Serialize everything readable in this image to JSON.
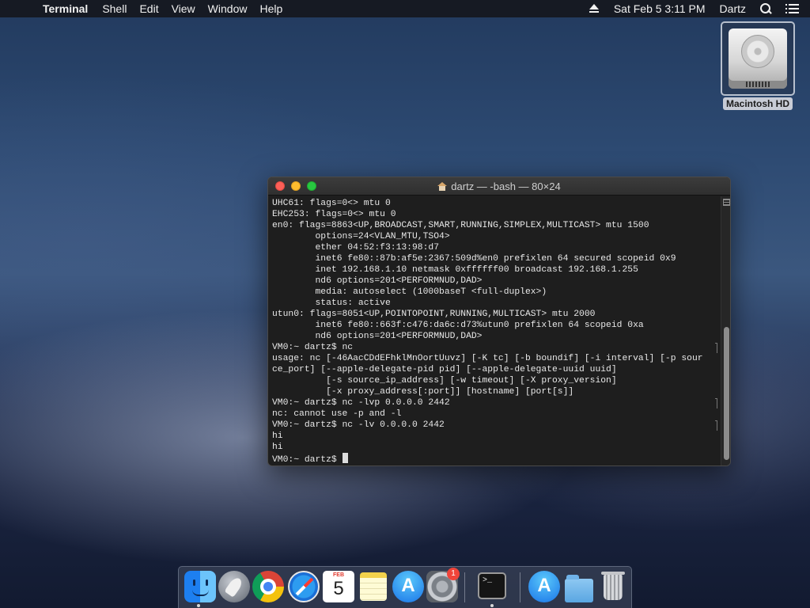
{
  "menubar": {
    "apple_glyph": "",
    "app_name": "Terminal",
    "menus": [
      "Shell",
      "Edit",
      "View",
      "Window",
      "Help"
    ],
    "clock": "Sat Feb 5  3:11 PM",
    "user": "Dartz"
  },
  "desktop": {
    "drive_label": "Macintosh HD"
  },
  "terminal": {
    "title": "dartz — -bash — 80×24",
    "lines": [
      "UHC61: flags=0<> mtu 0",
      "EHC253: flags=0<> mtu 0",
      "en0: flags=8863<UP,BROADCAST,SMART,RUNNING,SIMPLEX,MULTICAST> mtu 1500",
      "        options=24<VLAN_MTU,TSO4>",
      "        ether 04:52:f3:13:98:d7",
      "        inet6 fe80::87b:af5e:2367:509d%en0 prefixlen 64 secured scopeid 0x9",
      "        inet 192.168.1.10 netmask 0xffffff00 broadcast 192.168.1.255",
      "        nd6 options=201<PERFORMNUD,DAD>",
      "        media: autoselect (1000baseT <full-duplex>)",
      "        status: active",
      "utun0: flags=8051<UP,POINTOPOINT,RUNNING,MULTICAST> mtu 2000",
      "        inet6 fe80::663f:c476:da6c:d73%utun0 prefixlen 64 scopeid 0xa",
      "        nd6 options=201<PERFORMNUD,DAD>",
      "VM0:~ dartz$ nc",
      "usage: nc [-46AacCDdEFhklMnOortUuvz] [-K tc] [-b boundif] [-i interval] [-p sour",
      "ce_port] [--apple-delegate-pid pid] [--apple-delegate-uuid uuid]",
      "          [-s source_ip_address] [-w timeout] [-X proxy_version]",
      "          [-x proxy_address[:port]] [hostname] [port[s]]",
      "VM0:~ dartz$ nc -lvp 0.0.0.0 2442",
      "nc: cannot use -p and -l",
      "VM0:~ dartz$ nc -lv 0.0.0.0 2442",
      "hi",
      "hi"
    ],
    "prompt": "VM0:~ dartz$ "
  },
  "dock": {
    "calendar_month": "FEB",
    "calendar_day": "5",
    "sysprefs_badge": "1",
    "terminal_glyph": ">_",
    "appstore_glyph": "A"
  }
}
